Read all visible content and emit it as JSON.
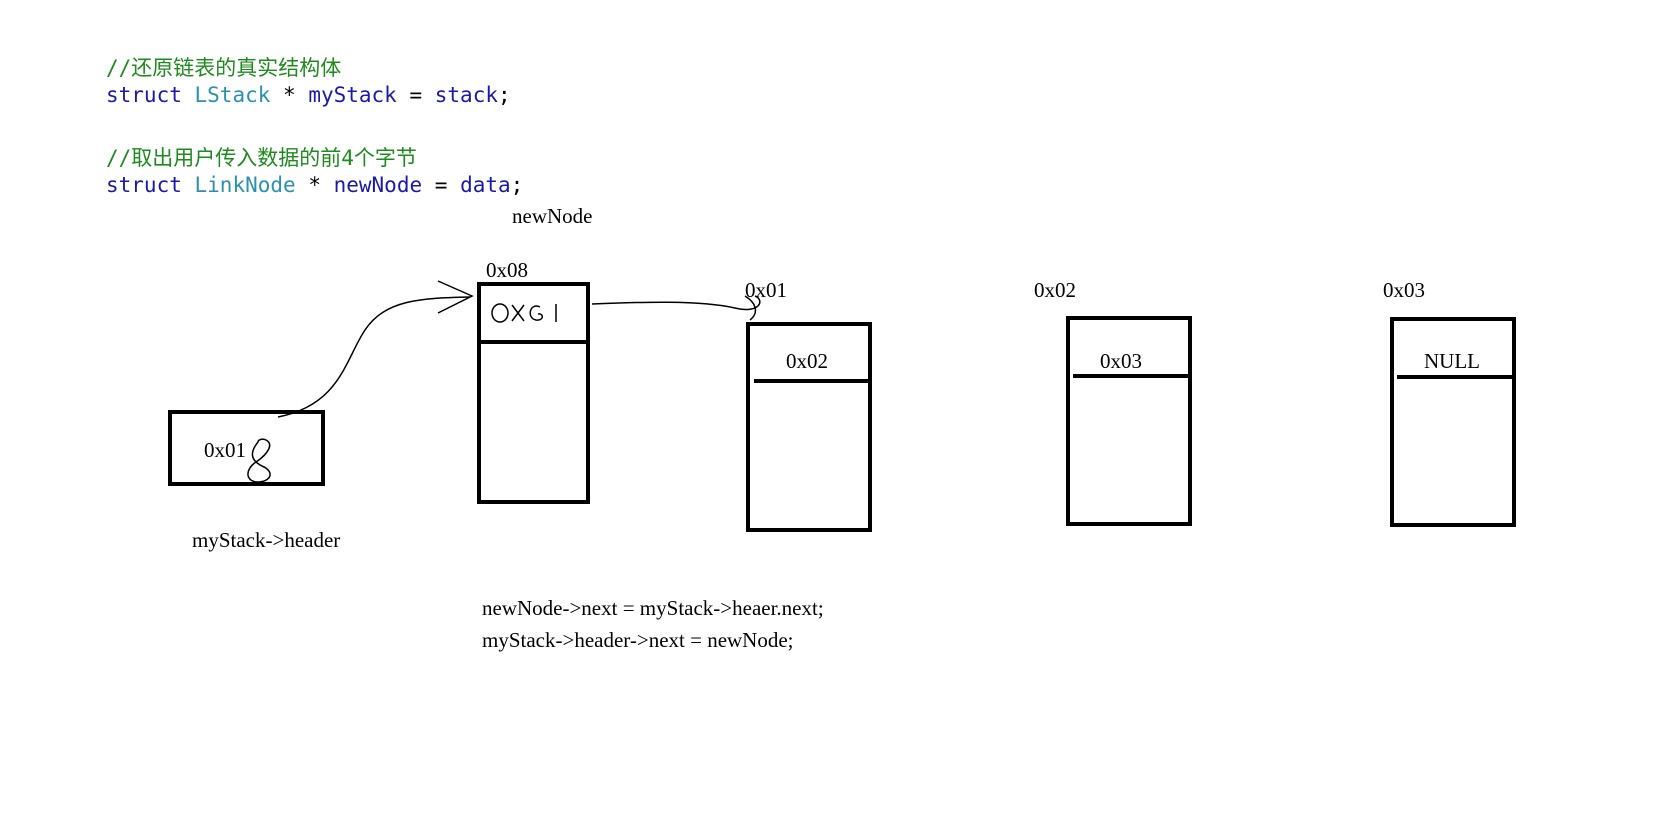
{
  "code": {
    "comment1": "//还原链表的真实结构体",
    "line1": {
      "kw": "struct",
      "type": "LStack",
      "op": " * ",
      "var": "myStack",
      "eq": " = ",
      "val": "stack",
      "end": ";"
    },
    "comment2": "//取出用户传入数据的前4个字节",
    "line2": {
      "kw": "struct",
      "type": "LinkNode",
      "op": " * ",
      "var": "newNode",
      "eq": " = ",
      "val": "data",
      "end": ";"
    }
  },
  "diagram": {
    "header_value": "0x01",
    "header_value_overwrite": "8",
    "header_label": "myStack->header",
    "new_node_label": "newNode",
    "new_node_address": "0x08",
    "new_node_next": "0x01",
    "nodes": [
      {
        "address": "0x01",
        "next": "0x02"
      },
      {
        "address": "0x02",
        "next": "0x03"
      },
      {
        "address": "0x03",
        "next": "NULL"
      }
    ],
    "statements": [
      "newNode->next = myStack->heaer.next;",
      "myStack->header->next = newNode;"
    ]
  }
}
